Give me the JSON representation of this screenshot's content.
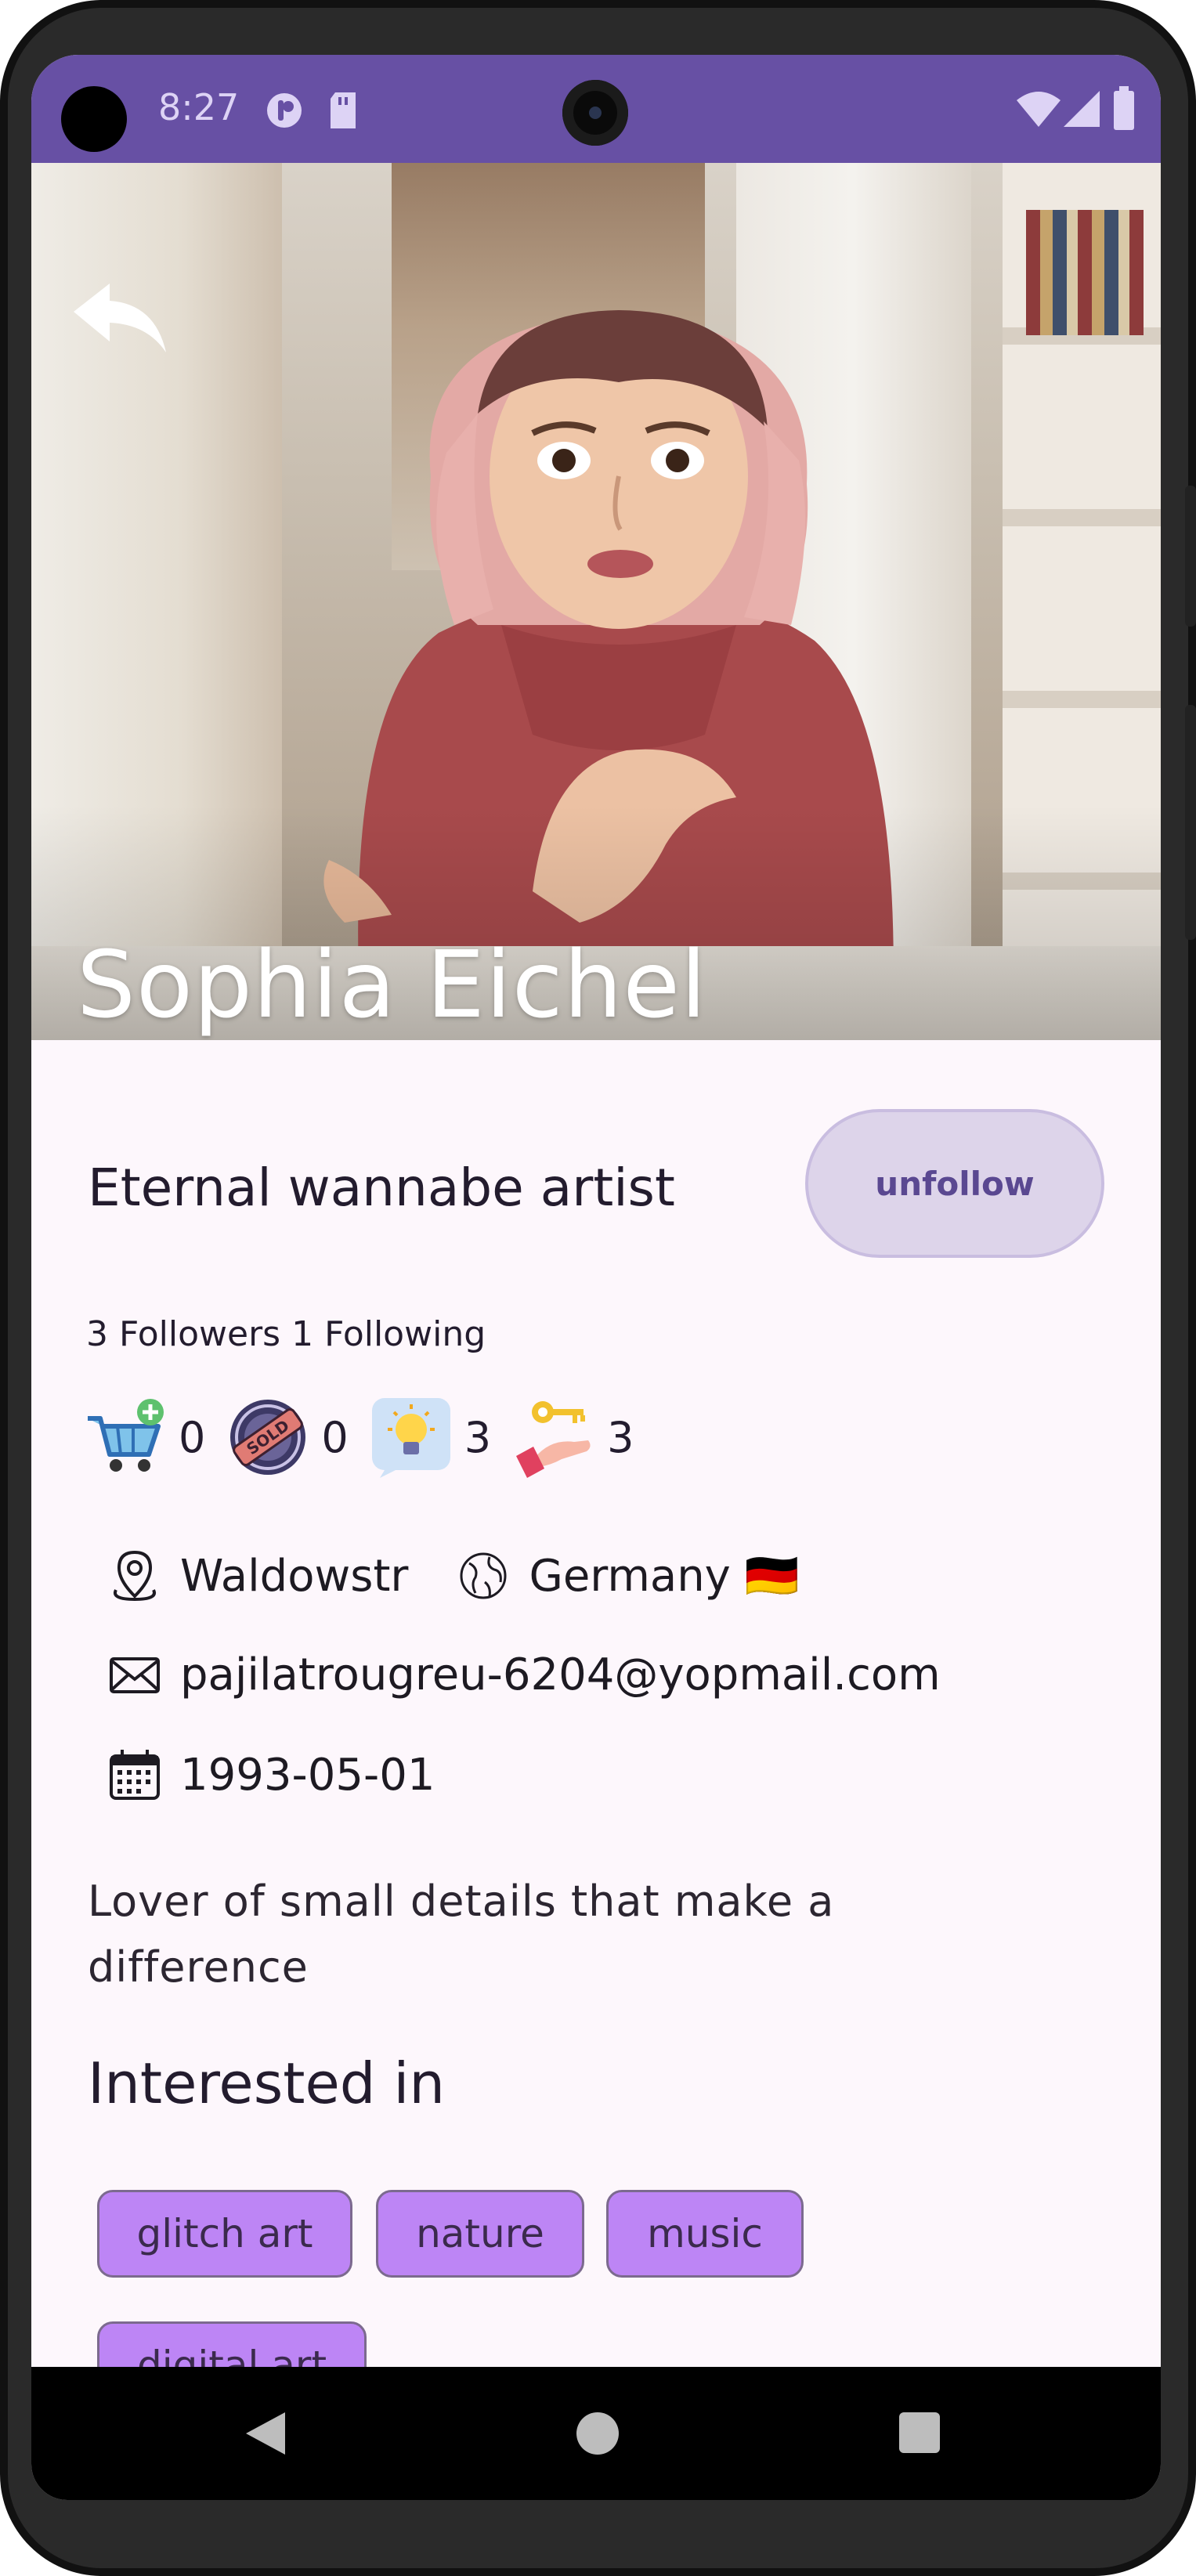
{
  "status_bar": {
    "time": "8:27",
    "icons": [
      "notification-p-icon",
      "sd-card-icon",
      "wifi-icon",
      "signal-icon",
      "battery-icon"
    ],
    "color": "#6750a4"
  },
  "profile": {
    "name": "Sophia Eichel",
    "tagline": "Eternal wannabe artist",
    "unfollow_label": "unfollow",
    "followers": "3 Followers",
    "following": "1 Following",
    "stats": [
      {
        "icon": "cart-add-icon",
        "value": "0"
      },
      {
        "icon": "sold-stamp-icon",
        "value": "0"
      },
      {
        "icon": "lightbulb-idea-icon",
        "value": "3"
      },
      {
        "icon": "hand-key-icon",
        "value": "3"
      }
    ],
    "street": "Waldowstr",
    "country": "Germany 🇩🇪",
    "email": "pajilatrougreu-6204@yopmail.com",
    "birthdate": "1993-05-01",
    "bio": "Lover of small details that make a difference",
    "interests_title": "Interested in",
    "interests": [
      "glitch art",
      "nature",
      "music",
      "digital art"
    ]
  },
  "colors": {
    "accent": "#6750a4",
    "chip": "#bd85f5",
    "button_bg": "#ddd4ea",
    "background": "#fdf7fc"
  }
}
